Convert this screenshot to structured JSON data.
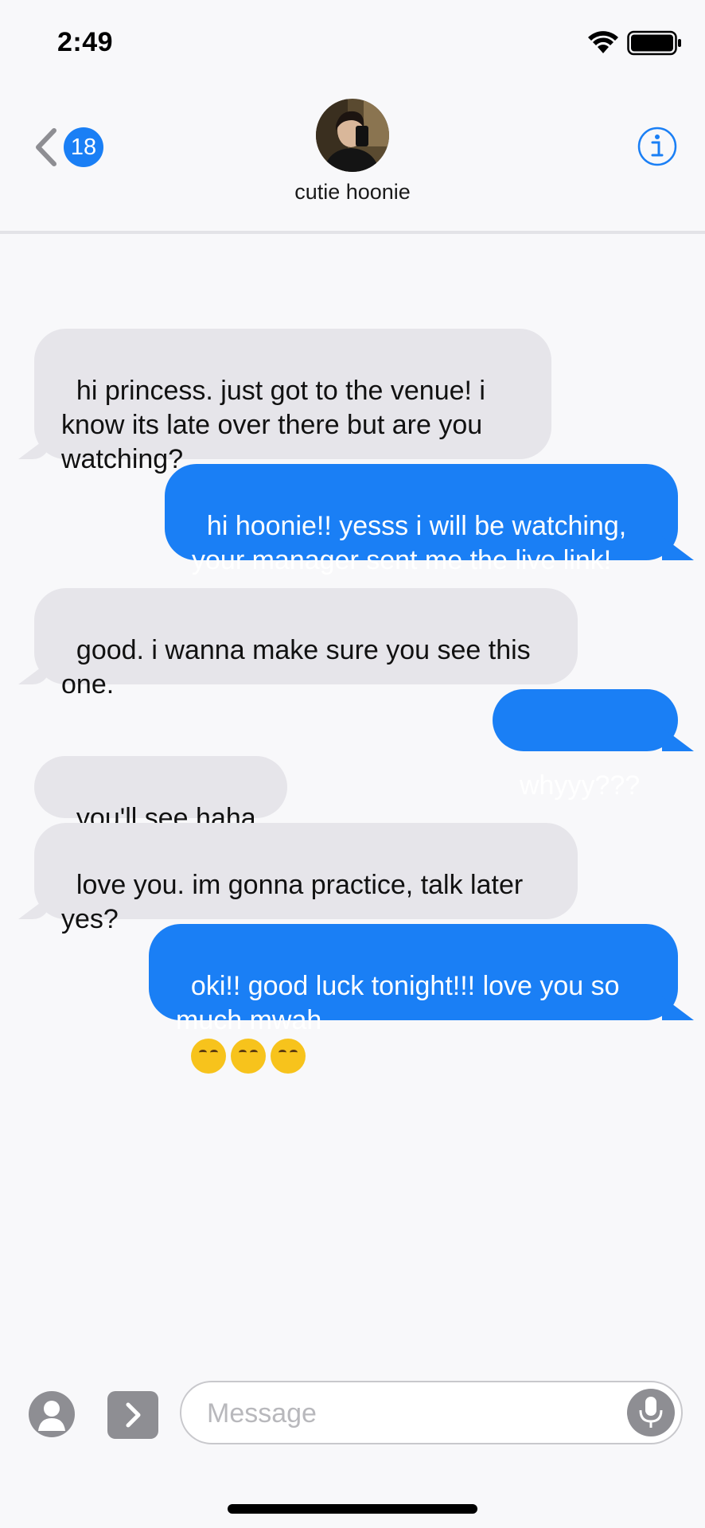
{
  "status": {
    "time": "2:49"
  },
  "nav": {
    "unread_count": "18",
    "contact_name": "cutie hoonie"
  },
  "messages": [
    {
      "from": "received",
      "text": "hi princess. just got to the venue! i know its late over there but are you watching?"
    },
    {
      "from": "sent",
      "text": "hi hoonie!! yesss i will be watching, your manager sent me the live link!"
    },
    {
      "from": "received",
      "text": "good. i wanna make sure you see this one."
    },
    {
      "from": "sent",
      "text": "whyyy???"
    },
    {
      "from": "received",
      "text": "you'll see haha"
    },
    {
      "from": "received",
      "text": "love you. im gonna practice, talk later yes?"
    },
    {
      "from": "sent",
      "text": "oki!! good luck tonight!!! love you so much mwah",
      "emoji_count": 3,
      "emoji_icon": "kissing-face-icon"
    }
  ],
  "input": {
    "placeholder": "Message"
  },
  "colors": {
    "accent": "#1a7ff5",
    "received_bubble": "#e6e5ea"
  }
}
